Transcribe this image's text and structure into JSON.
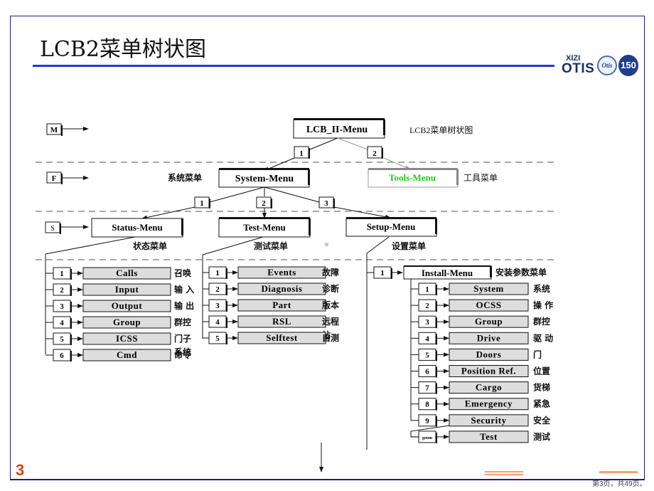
{
  "slide": {
    "title": "LCB2菜单树状图",
    "page_number": "3",
    "page_info": "第3页，共49页。"
  },
  "logo": {
    "xizi": "XIZI",
    "otis": "OTIS",
    "globe_text": "Otis",
    "badge_text": "150"
  },
  "levels": {
    "M": "M",
    "F": "F",
    "S": "S"
  },
  "root": {
    "label": "LCB_II-Menu",
    "caption": "LCB2菜单树状图",
    "branch_1": "1",
    "branch_2": "2"
  },
  "system_menu": {
    "label": "System-Menu",
    "caption": "系统菜单",
    "branches": [
      "1",
      "2",
      "3"
    ]
  },
  "tools_menu": {
    "label": "Tools-Menu",
    "caption": "工具菜单",
    "color": "#22cc22"
  },
  "status_menu": {
    "label": "Status-Menu",
    "caption": "状态菜单",
    "items": [
      {
        "num": "1",
        "label": "Calls",
        "cn": "召唤"
      },
      {
        "num": "2",
        "label": "Input",
        "cn": "输 入"
      },
      {
        "num": "3",
        "label": "Output",
        "cn": "输 出"
      },
      {
        "num": "4",
        "label": "Group",
        "cn": "群控"
      },
      {
        "num": "5",
        "label": "ICSS",
        "cn": "门子",
        "cn2": "系统"
      },
      {
        "num": "6",
        "label": "Cmd",
        "cn": "命令"
      }
    ]
  },
  "test_menu": {
    "label": "Test-Menu",
    "caption": "测试菜单",
    "items": [
      {
        "num": "1",
        "label": "Events",
        "cn": "故障"
      },
      {
        "num": "2",
        "label": "Diagnosis",
        "cn": "诊断"
      },
      {
        "num": "3",
        "label": "Part",
        "cn": "版本"
      },
      {
        "num": "4",
        "label": "RSL",
        "cn": "远程",
        "cn2": "站"
      },
      {
        "num": "5",
        "label": "Selftest",
        "cn": "自测"
      }
    ]
  },
  "setup_menu": {
    "label": "Setup-Menu",
    "caption": "设置菜单",
    "install": {
      "num": "1",
      "label": "Install-Menu",
      "cn": "安装参数菜单"
    },
    "items": [
      {
        "num": "1",
        "label": "System",
        "cn": "系统"
      },
      {
        "num": "2",
        "label": "OCSS",
        "cn": "操 作"
      },
      {
        "num": "3",
        "label": "Group",
        "cn": "群控"
      },
      {
        "num": "4",
        "label": "Drive",
        "cn": "驱 动"
      },
      {
        "num": "5",
        "label": "Doors",
        "cn": "门"
      },
      {
        "num": "6",
        "label": "Position Ref.",
        "cn": "位置"
      },
      {
        "num": "7",
        "label": "Cargo",
        "cn": "货梯"
      },
      {
        "num": "8",
        "label": "Emergency",
        "cn": "紧急"
      },
      {
        "num": "9",
        "label": "Security",
        "cn": "安全"
      },
      {
        "num": "goom",
        "label": "Test",
        "cn": "测试"
      }
    ]
  }
}
